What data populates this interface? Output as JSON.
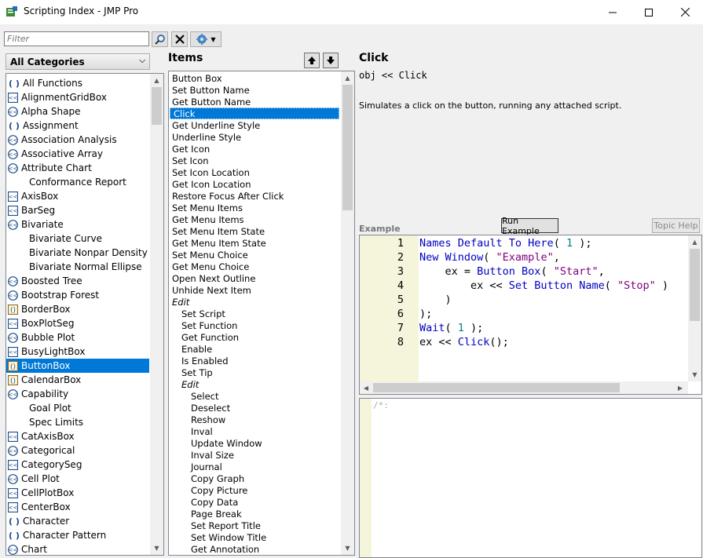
{
  "window": {
    "title": "Scripting Index - JMP Pro"
  },
  "toolbar": {
    "filter_placeholder": "Filter"
  },
  "categories": {
    "selected": "All Categories",
    "items": [
      {
        "label": "All Functions",
        "icon": "paren"
      },
      {
        "label": "AlignmentGridBox",
        "icon": "box"
      },
      {
        "label": "Alpha Shape",
        "icon": "platform"
      },
      {
        "label": "Assignment",
        "icon": "paren"
      },
      {
        "label": "Association Analysis",
        "icon": "platform"
      },
      {
        "label": "Associative Array",
        "icon": "platform"
      },
      {
        "label": "Attribute Chart",
        "icon": "platform"
      },
      {
        "label": "Conformance Report",
        "icon": "none"
      },
      {
        "label": "AxisBox",
        "icon": "box"
      },
      {
        "label": "BarSeg",
        "icon": "box"
      },
      {
        "label": "Bivariate",
        "icon": "platform"
      },
      {
        "label": "Bivariate Curve",
        "icon": "none"
      },
      {
        "label": "Bivariate Nonpar Density",
        "icon": "none"
      },
      {
        "label": "Bivariate Normal Ellipse",
        "icon": "none"
      },
      {
        "label": "Boosted Tree",
        "icon": "platform"
      },
      {
        "label": "Bootstrap Forest",
        "icon": "platform"
      },
      {
        "label": "BorderBox",
        "icon": "dispbox"
      },
      {
        "label": "BoxPlotSeg",
        "icon": "box"
      },
      {
        "label": "Bubble Plot",
        "icon": "platform"
      },
      {
        "label": "BusyLightBox",
        "icon": "box"
      },
      {
        "label": "ButtonBox",
        "icon": "dispbox"
      },
      {
        "label": "CalendarBox",
        "icon": "dispbox"
      },
      {
        "label": "Capability",
        "icon": "platform"
      },
      {
        "label": "Goal Plot",
        "icon": "none"
      },
      {
        "label": "Spec Limits",
        "icon": "none"
      },
      {
        "label": "CatAxisBox",
        "icon": "box"
      },
      {
        "label": "Categorical",
        "icon": "platform"
      },
      {
        "label": "CategorySeg",
        "icon": "box"
      },
      {
        "label": "Cell Plot",
        "icon": "platform"
      },
      {
        "label": "CellPlotBox",
        "icon": "box"
      },
      {
        "label": "CenterBox",
        "icon": "box"
      },
      {
        "label": "Character",
        "icon": "paren"
      },
      {
        "label": "Character Pattern",
        "icon": "paren"
      },
      {
        "label": "Chart",
        "icon": "platform"
      }
    ]
  },
  "items_panel": {
    "title": "Items",
    "items": [
      {
        "label": "Button Box",
        "level": 0
      },
      {
        "label": "Set Button Name",
        "level": 0
      },
      {
        "label": "Get Button Name",
        "level": 0
      },
      {
        "label": "Click",
        "level": 0
      },
      {
        "label": "Get Underline Style",
        "level": 0
      },
      {
        "label": "Underline Style",
        "level": 0
      },
      {
        "label": "Get Icon",
        "level": 0
      },
      {
        "label": "Set Icon",
        "level": 0
      },
      {
        "label": "Set Icon Location",
        "level": 0
      },
      {
        "label": "Get Icon Location",
        "level": 0
      },
      {
        "label": "Restore Focus After Click",
        "level": 0
      },
      {
        "label": "Set Menu Items",
        "level": 0
      },
      {
        "label": "Get Menu Items",
        "level": 0
      },
      {
        "label": "Set Menu Item State",
        "level": 0
      },
      {
        "label": "Get Menu Item State",
        "level": 0
      },
      {
        "label": "Set Menu Choice",
        "level": 0
      },
      {
        "label": "Get Menu Choice",
        "level": 0
      },
      {
        "label": "Open Next Outline",
        "level": 0
      },
      {
        "label": "Unhide Next Item",
        "level": 0
      },
      {
        "label": "Edit",
        "level": 0,
        "header": true
      },
      {
        "label": "Set Script",
        "level": 1
      },
      {
        "label": "Set Function",
        "level": 1
      },
      {
        "label": "Get Function",
        "level": 1
      },
      {
        "label": "Enable",
        "level": 1
      },
      {
        "label": "Is Enabled",
        "level": 1
      },
      {
        "label": "Set Tip",
        "level": 1
      },
      {
        "label": "Edit",
        "level": 1,
        "header": true
      },
      {
        "label": "Select",
        "level": 2
      },
      {
        "label": "Deselect",
        "level": 2
      },
      {
        "label": "Reshow",
        "level": 2
      },
      {
        "label": "Inval",
        "level": 2
      },
      {
        "label": "Update Window",
        "level": 2
      },
      {
        "label": "Inval Size",
        "level": 2
      },
      {
        "label": "Journal",
        "level": 2
      },
      {
        "label": "Copy Graph",
        "level": 2
      },
      {
        "label": "Copy Picture",
        "level": 2
      },
      {
        "label": "Copy Data",
        "level": 2
      },
      {
        "label": "Page Break",
        "level": 2
      },
      {
        "label": "Set Report Title",
        "level": 2
      },
      {
        "label": "Set Window Title",
        "level": 2
      },
      {
        "label": "Get Annotation",
        "level": 2
      }
    ]
  },
  "detail": {
    "title": "Click",
    "signature": "obj << Click",
    "description": "Simulates a click on the button, running any attached script.",
    "example_label": "Example",
    "run_button": "Run Example",
    "help_button": "Topic Help",
    "code_lines": [
      "1",
      "2",
      "3",
      "4",
      "5",
      "6",
      "7",
      "8"
    ],
    "log_text": "/*:"
  },
  "colors": {
    "selection": "#0078d7",
    "gutter": "#f5f5dc",
    "keyword": "#0000c0",
    "string": "#800080",
    "number": "#008080"
  }
}
